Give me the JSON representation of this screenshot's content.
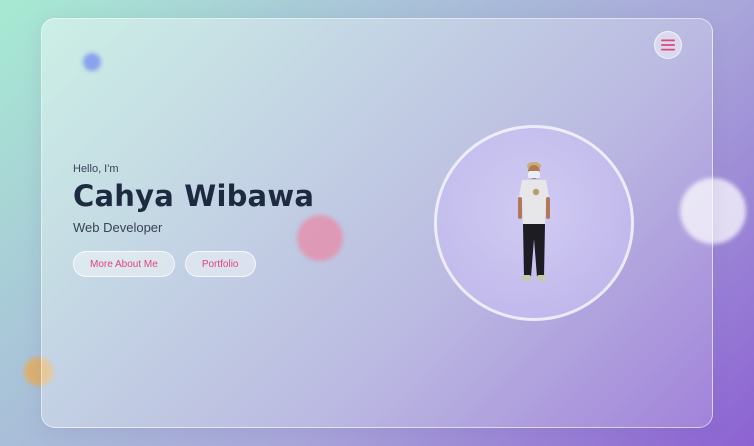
{
  "menu": {
    "icon": "hamburger-icon"
  },
  "hero": {
    "greeting": "Hello, I'm",
    "name": "Cahya Wibawa",
    "role": "Web Developer",
    "buttons": [
      {
        "label": "More About Me"
      },
      {
        "label": "Portfolio"
      }
    ]
  },
  "avatar": {
    "icon": "person-photo"
  },
  "colors": {
    "accent": "#e0457c",
    "heading": "#1e2a40",
    "text": "#3a4256"
  }
}
